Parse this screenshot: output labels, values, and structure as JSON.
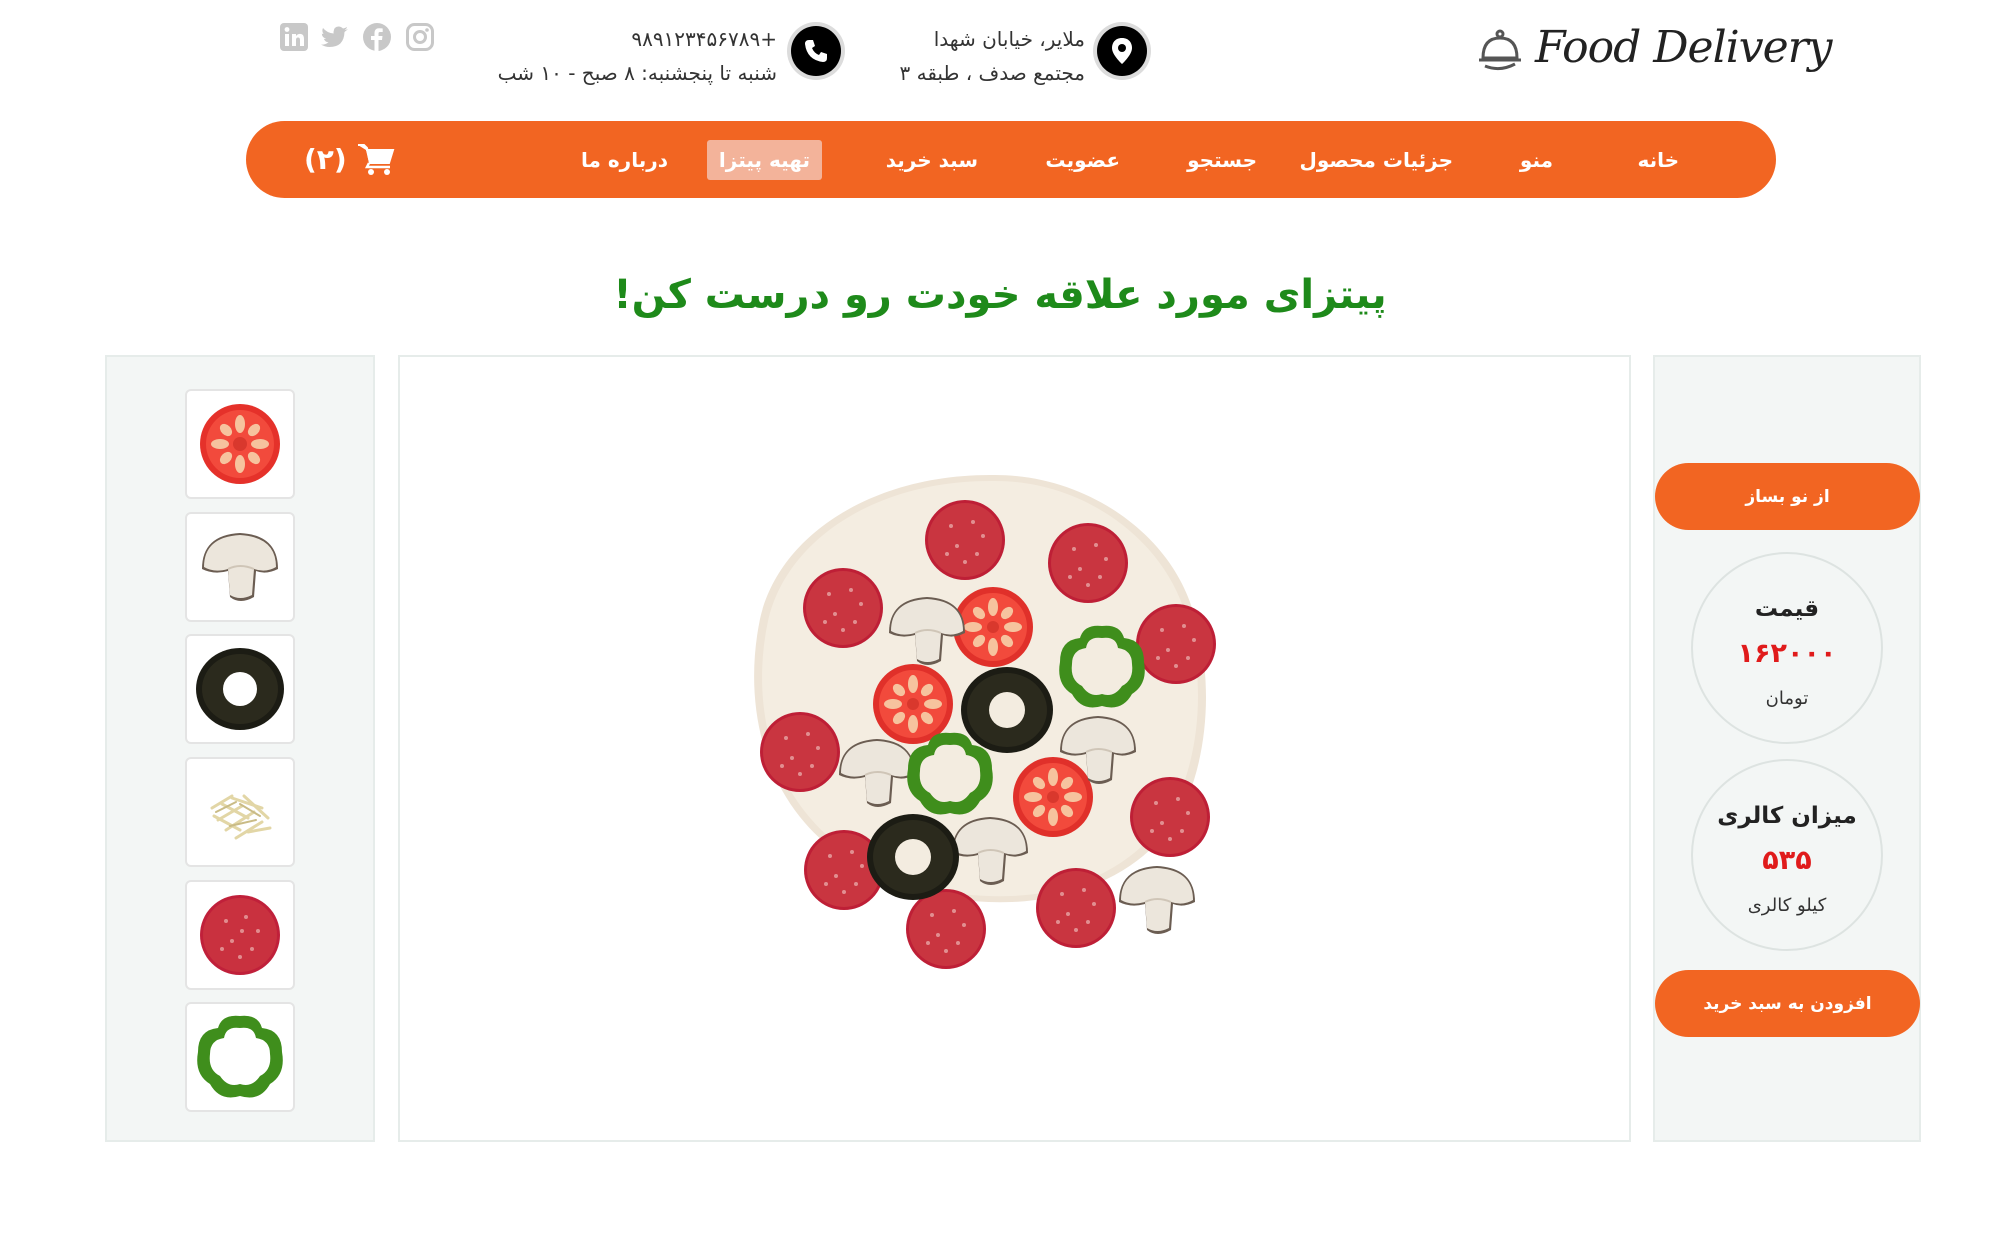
{
  "brand": {
    "name": "Food Delivery"
  },
  "contact": {
    "address_line1": "ملایر، خیابان شهدا",
    "address_line2": "مجتمع صدف ، طبقه ۳",
    "phone": "+۹۸۹۱۲۳۴۵۶۷۸۹",
    "hours": "شنبه تا پنجشنبه: ۸ صبح - ۱۰ شب"
  },
  "social": [
    "instagram-icon",
    "facebook-icon",
    "twitter-icon",
    "linkedin-icon"
  ],
  "nav": {
    "items": [
      "خانه",
      "منو",
      "جزئیات محصول",
      "جستجو",
      "عضویت",
      "سبد خرید",
      "تهیه پیتزا",
      "درباره ما"
    ],
    "active": "تهیه پیتزا",
    "cart_count": "(۲)"
  },
  "heading": "پیتزای مورد علاقه خودت رو درست کن!",
  "ingredients": [
    "tomato",
    "mushroom",
    "olive",
    "cheese",
    "salami",
    "pepper"
  ],
  "actions": {
    "reset_label": "از نو بساز",
    "add_to_cart_label": "افزودن به سبد خرید"
  },
  "price": {
    "title": "قیمت",
    "value": "۱۶۲۰۰۰",
    "unit": "تومان"
  },
  "calories": {
    "title": "میزان کالری",
    "value": "۵۳۵",
    "unit": "کیلو کالری"
  },
  "colors": {
    "accent": "#f26522",
    "heading": "#1e8a1a",
    "value": "#e01b1b"
  }
}
